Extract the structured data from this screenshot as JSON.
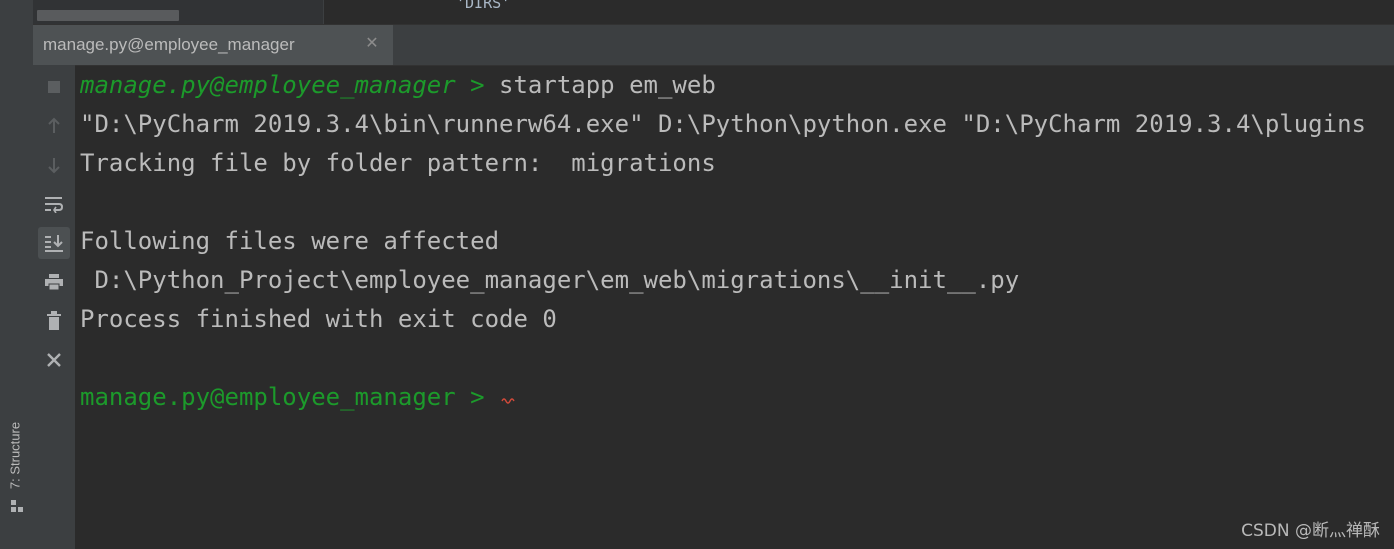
{
  "editor": {
    "visible_text": "'DIRS'"
  },
  "terminal_tab": {
    "title": "manage.py@employee_manager",
    "close_glyph": "✕"
  },
  "left_strip": {
    "structure_label": "7: Structure"
  },
  "toolbar": {
    "buttons": [
      "stop-icon",
      "scroll-up-icon",
      "scroll-down-icon",
      "soft-wrap-icon",
      "scroll-to-end-icon",
      "print-icon",
      "trash-icon",
      "close-icon"
    ],
    "active": "scroll-to-end-icon"
  },
  "terminal": {
    "lines": [
      {
        "prompt": "manage.py@employee_manager > ",
        "text": "startapp em_web"
      },
      {
        "text": "\"D:\\PyCharm 2019.3.4\\bin\\runnerw64.exe\" D:\\Python\\python.exe \"D:\\PyCharm 2019.3.4\\plugins"
      },
      {
        "text": "Tracking file by folder pattern:  migrations"
      },
      {
        "text": ""
      },
      {
        "text": "Following files were affected"
      },
      {
        "text": " D:\\Python_Project\\employee_manager\\em_web\\migrations\\__init__.py"
      },
      {
        "text": "Process finished with exit code 0"
      },
      {
        "text": ""
      },
      {
        "prompt": "manage.py@employee_manager > ",
        "text": ""
      }
    ]
  },
  "colors": {
    "background": "#2b2b2b",
    "prompt": "#1c9a2b",
    "text": "#bbbbbb",
    "panel": "#3c3f41"
  },
  "watermark": "CSDN @断灬禅酥"
}
